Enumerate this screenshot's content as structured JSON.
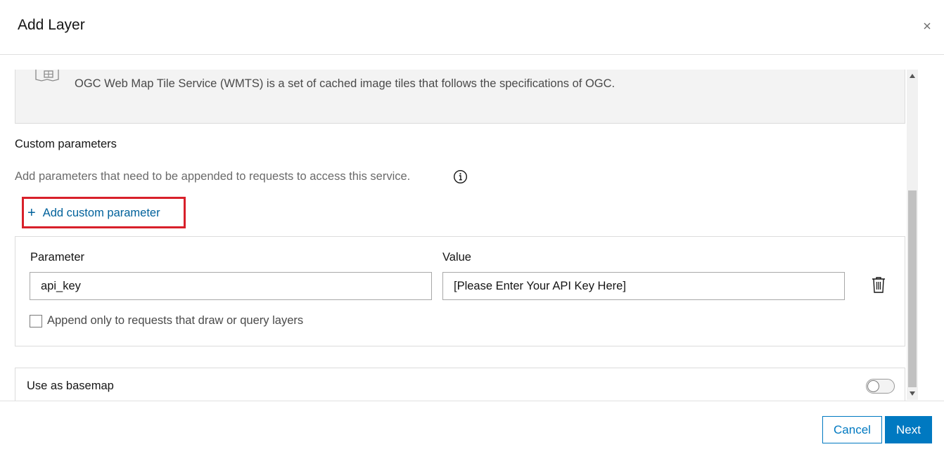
{
  "dialog": {
    "title": "Add Layer",
    "close_icon": "close-icon"
  },
  "service": {
    "icon": "map-tiles-icon",
    "description": "OGC Web Map Tile Service (WMTS) is a set of cached image tiles that follows the specifications of OGC."
  },
  "custom_parameters": {
    "title": "Custom parameters",
    "description": "Add parameters that need to be appended to requests to access this service.",
    "info_icon": "info-icon",
    "add_button_plus": "+",
    "add_button_label": "Add custom parameter",
    "parameter_label": "Parameter",
    "value_label": "Value",
    "parameter_value": "api_key",
    "value_value": "[Please Enter Your API Key Here]",
    "delete_icon": "trash-icon",
    "append_only_label": "Append only to requests that draw or query layers",
    "append_only_checked": false
  },
  "basemap": {
    "label": "Use as basemap",
    "enabled": false
  },
  "footer": {
    "cancel_label": "Cancel",
    "next_label": "Next"
  },
  "colors": {
    "accent": "#0079c1",
    "link": "#00619b",
    "highlight": "#d8202a"
  }
}
